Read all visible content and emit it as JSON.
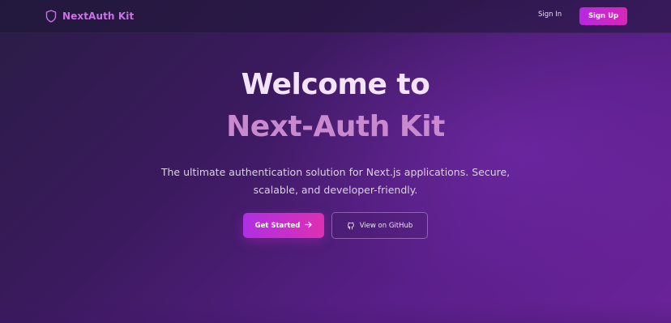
{
  "navbar": {
    "brand_name": "NextAuth Kit",
    "brand_icon": "shield-icon",
    "signin_label": "Sign In",
    "signup_label": "Sign Up"
  },
  "hero": {
    "title_line1": "Welcome to",
    "title_line2": "Next-Auth Kit",
    "subtitle": "The ultimate authentication solution for Next.js applications. Secure, scalable, and developer-friendly.",
    "primary_cta": "Get Started",
    "primary_cta_icon": "arrow-right-icon",
    "secondary_cta": "View on GitHub",
    "secondary_cta_icon": "github-icon"
  },
  "colors": {
    "accent": "#d06ee8",
    "button_gradient_start": "#b02fe3",
    "button_gradient_end": "#dd2fb3",
    "title_light": "#f3e4fb",
    "title_accent": "#c889cf"
  }
}
